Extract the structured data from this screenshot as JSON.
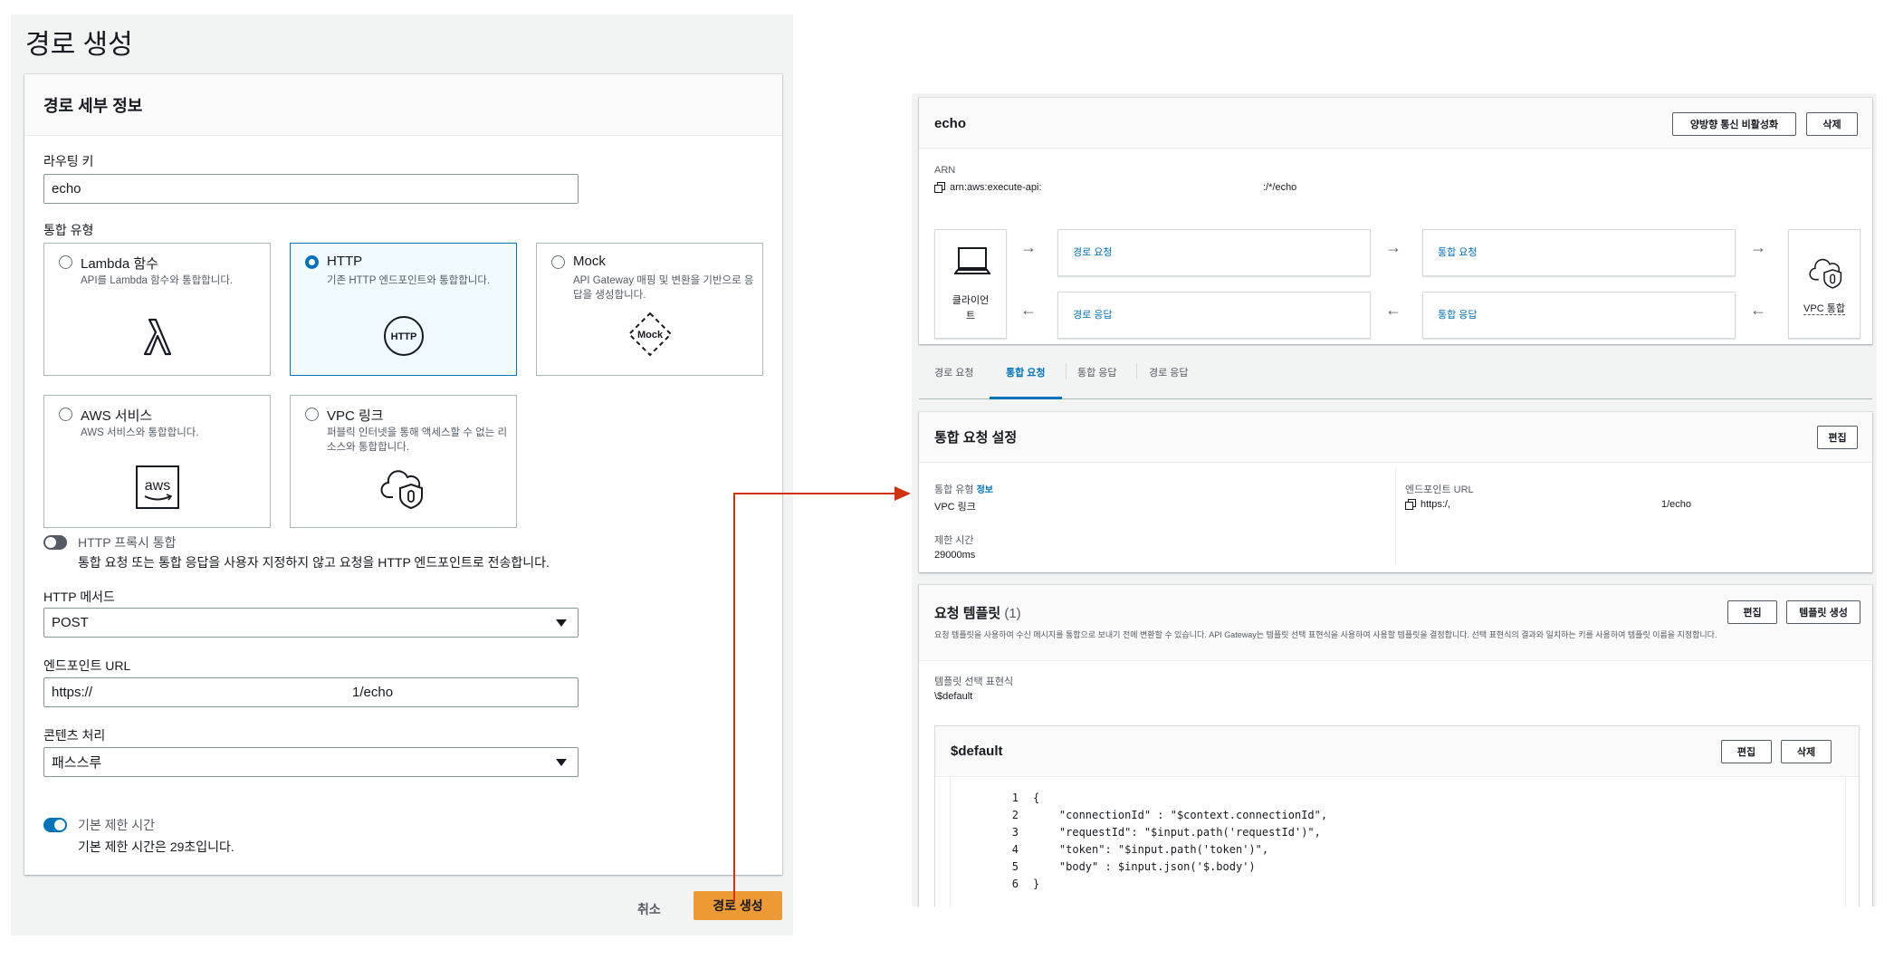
{
  "left": {
    "title": "경로 생성",
    "card_header": "경로 세부 정보",
    "routing_key_label": "라우팅 키",
    "routing_key_value": "echo",
    "integration_type_label": "통합 유형",
    "tiles": [
      {
        "title": "Lambda 함수",
        "desc": "API를 Lambda 함수와 통합합니다.",
        "icon": "lambda-icon",
        "selected": false
      },
      {
        "title": "HTTP",
        "desc": "기존 HTTP 엔드포인트와 통합합니다.",
        "icon": "http-icon",
        "icon_text": "HTTP",
        "selected": true
      },
      {
        "title": "Mock",
        "desc": "API Gateway 매핑 및 변환을 기반으로 응답을 생성합니다.",
        "icon": "mock-icon",
        "icon_text": "Mock",
        "selected": false
      },
      {
        "title": "AWS 서비스",
        "desc": "AWS 서비스와 통합합니다.",
        "icon": "aws-icon",
        "icon_text": "aws",
        "selected": false
      },
      {
        "title": "VPC 링크",
        "desc": "퍼블릭 인터넷을 통해 액세스할 수 없는 리소스와 통합합니다.",
        "icon": "cloud-shield-icon",
        "selected": false
      }
    ],
    "proxy_toggle_label": "HTTP 프록시 통합",
    "proxy_toggle_desc": "통합 요청 또는 통합 응답을 사용자 지정하지 않고 요청을 HTTP 엔드포인트로 전송합니다.",
    "proxy_toggle_on": false,
    "http_method_label": "HTTP 메서드",
    "http_method_value": "POST",
    "endpoint_label": "엔드포인트 URL",
    "endpoint_value_start": "https://",
    "endpoint_value_end": "1/echo",
    "content_label": "콘텐츠 처리",
    "content_value": "패스스루",
    "timeout_toggle_label": "기본 제한 시간",
    "timeout_toggle_desc": "기본 제한 시간은 29초입니다.",
    "timeout_toggle_on": true,
    "cancel_label": "취소",
    "create_label": "경로 생성"
  },
  "right": {
    "route_name": "echo",
    "disable_btn": "양방향 통신 비활성화",
    "delete_btn": "삭제",
    "arn_label": "ARN",
    "arn_start": "arn:aws:execute-api:",
    "arn_end": ":/*/echo",
    "client_label": "클라이언트",
    "route_request": "경로 요청",
    "integration_request": "통합 요청",
    "route_response": "경로 응답",
    "integration_response": "통합 응답",
    "vpc_integration": "VPC 통합",
    "tabs": [
      "경로 요청",
      "통합 요청",
      "통합 응답",
      "경로 응답"
    ],
    "active_tab": 1,
    "settings_title": "통합 요청 설정",
    "edit_btn": "편집",
    "integ_type_label": "통합 유형",
    "info_link": "정보",
    "integ_type_value": "VPC 링크",
    "timeout_label": "제한 시간",
    "timeout_value": "29000ms",
    "endpoint_label": "엔드포인트 URL",
    "endpoint_start": "https:/,",
    "endpoint_end": "1/echo",
    "templates_title": "요청 템플릿",
    "templates_count": "(1)",
    "templates_desc": "요청 템플릿을 사용하여 수신 메시지를 통합으로 보내기 전에 변환할 수 있습니다. API Gateway는 템플릿 선택 표현식을 사용하여 사용할 템플릿을 결정합니다. 선택 표현식의 결과와 일치하는 키를 사용하여 템플릿 이름을 지정합니다.",
    "create_template_btn": "템플릿 생성",
    "selection_expr_label": "템플릿 선택 표현식",
    "selection_expr_value": "\\$default",
    "template_name": "$default",
    "code_lines": [
      "{",
      "    \"connectionId\" : \"$context.connectionId\",",
      "    \"requestId\": \"$input.path('requestId')\",",
      "    \"token\": \"$input.path('token')\",",
      "    \"body\" : $input.json('$.body')",
      "}"
    ]
  },
  "colors": {
    "accent": "#0073bb",
    "primary_button": "#ec9a35",
    "connector_arrow": "#d13212"
  }
}
